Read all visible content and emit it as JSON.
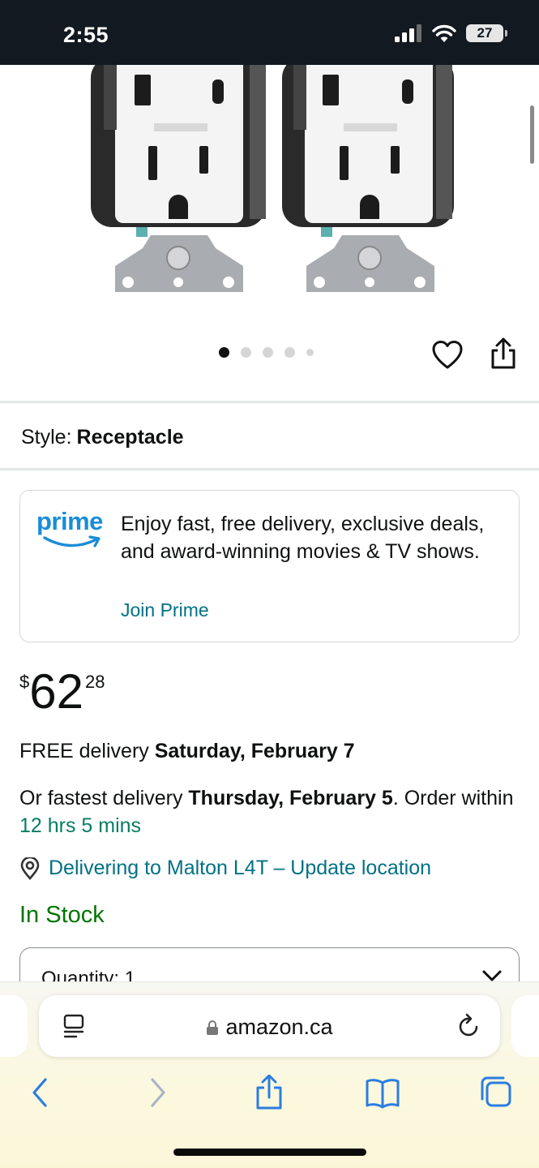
{
  "status_bar": {
    "time": "2:55",
    "battery": "27"
  },
  "carousel": {
    "dot_count": 5,
    "active_index": 0
  },
  "style": {
    "label": "Style:",
    "value": "Receptacle"
  },
  "prime": {
    "logo_text": "prime",
    "message": "Enjoy fast, free delivery, exclusive deals, and award-winning movies & TV shows.",
    "join_label": "Join Prime"
  },
  "price": {
    "symbol": "$",
    "whole": "62",
    "fraction": "28"
  },
  "delivery": {
    "free_prefix": "FREE delivery",
    "free_date": "Saturday, February 7",
    "fastest_prefix": "Or fastest delivery",
    "fastest_date": "Thursday, February 5",
    "order_suffix": ". Order within",
    "countdown": "12 hrs 5 mins"
  },
  "location": {
    "text": "Delivering to Malton L4T – Update location"
  },
  "stock": {
    "text": "In Stock"
  },
  "quantity": {
    "label": "Quantity: 1"
  },
  "browser": {
    "url": "amazon.ca"
  },
  "colors": {
    "status_bg": "#131921",
    "link": "#007185",
    "in_stock": "#007600",
    "countdown": "#067d62",
    "prime_blue": "#1a8cd8"
  }
}
